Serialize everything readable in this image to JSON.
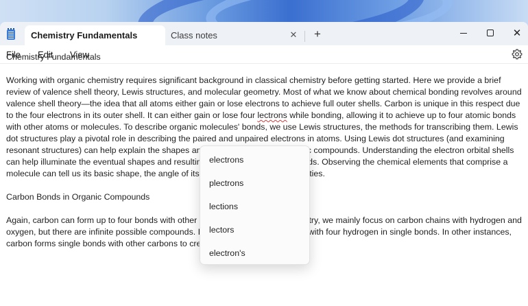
{
  "window": {
    "tabs": [
      {
        "label": "Chemistry Fundamentals",
        "active": true
      },
      {
        "label": "Class notes",
        "active": false
      }
    ],
    "new_tab_glyph": "+",
    "tab_close_glyph": "✕",
    "controls": {
      "minimize": "minimize-icon",
      "maximize": "maximize-icon",
      "close_glyph": "✕"
    }
  },
  "menu": {
    "items": [
      "File",
      "Edit",
      "View"
    ],
    "settings_icon": "gear-icon"
  },
  "document": {
    "title": "Chemistry Fundamentals",
    "para1_before": "Working with organic chemistry requires significant background in classical chemistry before getting started. Here we provide a brief review of valence shell theory, Lewis structures, and molecular geometry. Most of what we know about chemical bonding revolves around valence shell theory—the idea that all atoms either gain or lose electrons to achieve full outer shells. Carbon is unique in this respect due to the four electrons in its outer shell. It can either gain or lose four ",
    "para1_misspelled": "lectrons",
    "para1_after": " while bonding, allowing it to achieve up to four atomic bonds with other atoms or molecules. To describe organic molecules' bonds, we use Lewis structures, the methods for transcribing them. Lewis dot structures play a pivotal role in describing the paired and unpaired electrons in atoms. Using Lewis dot structures (and examining resonant structures) can help explain the shapes and bonding patterns of organic compounds. Understanding the electron orbital shells can help illuminate the eventual shapes and resulting bonds in organic compounds. Observing the chemical elements that comprise a molecule can tell us its basic shape, the angle of its bonds, and its unique properties.",
    "heading2": "Carbon Bonds in Organic Compounds",
    "para2": "Again, carbon can form up to four bonds with other molecules. In organic chemistry, we mainly focus on carbon chains with hydrogen and oxygen, but there are infinite possible compounds. In some cases, carbon binds with four hydrogen in single bonds. In other instances, carbon forms single bonds with other carbons to create longer chains."
  },
  "suggestions": {
    "items": [
      "electrons",
      "plectrons",
      "lections",
      "lectors",
      "electron's"
    ]
  },
  "colors": {
    "accent": "#3b7bd6",
    "squiggle": "#d23b3b",
    "titlebar": "#eef1f6"
  }
}
